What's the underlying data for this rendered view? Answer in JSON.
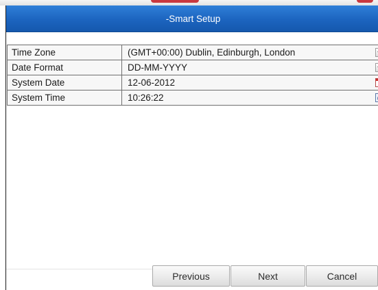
{
  "window": {
    "title": "-Smart Setup"
  },
  "settings": {
    "rows": [
      {
        "label": "Time Zone",
        "value": "(GMT+00:00) Dublin, Edinburgh, London",
        "control_icon": "dropdown-icon"
      },
      {
        "label": "Date Format",
        "value": "DD-MM-YYYY",
        "control_icon": "dropdown-icon"
      },
      {
        "label": "System Date",
        "value": "12-06-2012",
        "control_icon": "calendar-icon"
      },
      {
        "label": "System Time",
        "value": "10:26:22",
        "control_icon": "clock-icon"
      }
    ]
  },
  "footer": {
    "previous_label": "Previous",
    "next_label": "Next",
    "cancel_label": "Cancel"
  },
  "colors": {
    "title_bar": "#1f6ac6",
    "title_text": "#ffffff",
    "grid_line": "#6e6e6e"
  }
}
